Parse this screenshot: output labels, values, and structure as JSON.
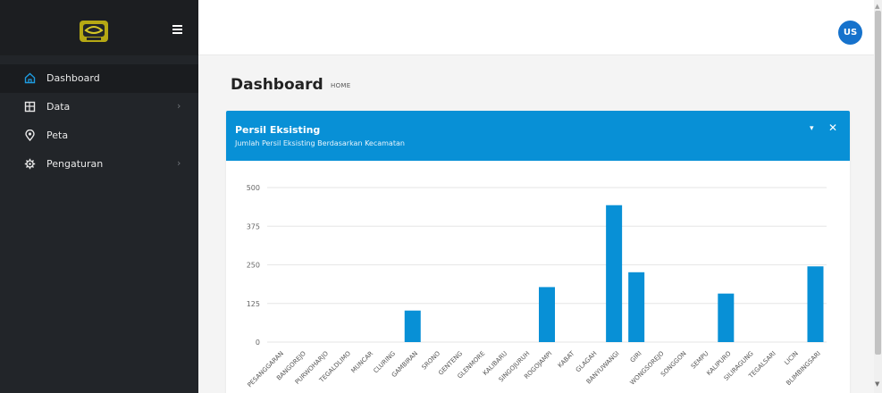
{
  "sidebar": {
    "logo": "logo-icon",
    "items": [
      {
        "label": "Dashboard",
        "icon": "home-icon",
        "active": true
      },
      {
        "label": "Data",
        "icon": "table-icon",
        "has_submenu": true
      },
      {
        "label": "Peta",
        "icon": "map-pin-icon"
      },
      {
        "label": "Pengaturan",
        "icon": "gear-icon",
        "has_submenu": true
      }
    ]
  },
  "topbar": {
    "avatar_initials": "US"
  },
  "page": {
    "title": "Dashboard",
    "breadcrumb": "HOME"
  },
  "card": {
    "title": "Persil Eksisting",
    "subtitle": "Jumlah Persil Eksisting Berdasarkan Kecamatan",
    "collapse_symbol": "▾",
    "close_symbol": "✕"
  },
  "colors": {
    "accent": "#0890d6",
    "sidebar": "#222529",
    "avatar": "#1672cc"
  },
  "chart_data": {
    "type": "bar",
    "title": "",
    "xlabel": "",
    "ylabel": "",
    "ylim": [
      0,
      500
    ],
    "yticks": [
      0,
      125,
      250,
      375,
      500
    ],
    "grid": true,
    "legend": "none",
    "categories": [
      "PESANGGARAN",
      "BANGOREJO",
      "PURWOHARJO",
      "TEGALDLIMO",
      "MUNCAR",
      "CLURING",
      "GAMBIRAN",
      "SRONO",
      "GENTENG",
      "GLENMORE",
      "KALIBARU",
      "SINGOJURUH",
      "ROGOJAMPI",
      "KABAT",
      "GLAGAH",
      "BANYUWANGI",
      "GIRI",
      "WONGSOREJO",
      "SONGGON",
      "SEMPU",
      "KALIPURO",
      "SILIRAGUNG",
      "TEGALSARI",
      "LICIN",
      "BLIMBINGSARI"
    ],
    "values": [
      0,
      0,
      0,
      0,
      0,
      0,
      102,
      0,
      0,
      0,
      0,
      0,
      178,
      0,
      0,
      443,
      226,
      0,
      0,
      0,
      157,
      0,
      0,
      0,
      245
    ],
    "bar_color": "#0890d6"
  }
}
